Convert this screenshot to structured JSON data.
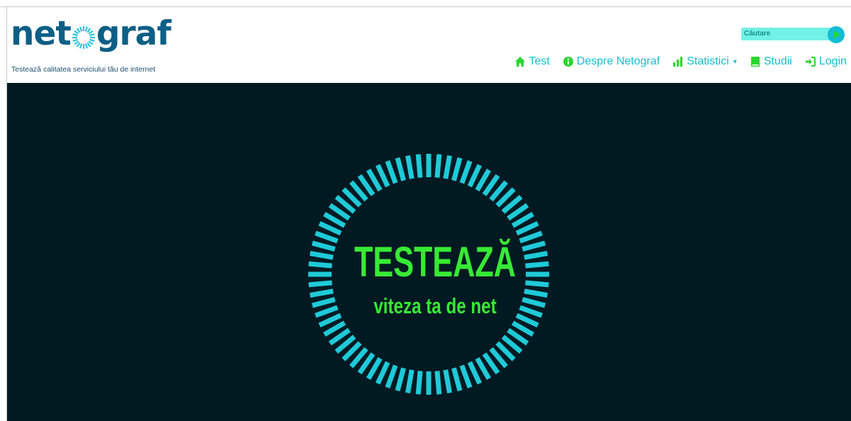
{
  "brand": {
    "logo_prefix": "net",
    "logo_suffix": "graf",
    "tagline": "Testează calitatea serviciului tău de internet"
  },
  "search": {
    "placeholder": "Căutare"
  },
  "nav": {
    "test": "Test",
    "about": "Despre Netograf",
    "stats": "Statistici",
    "studies": "Studii",
    "login": "Login"
  },
  "hero": {
    "title": "TESTEAZĂ",
    "subtitle": "viteza ta de net"
  },
  "colors": {
    "logo_blue": "#0d5f86",
    "accent_cyan": "#11bfcf",
    "accent_green": "#37ea34",
    "hero_bg": "#011a22",
    "dial_cyan": "#1fcad8"
  },
  "icons": {
    "test": "home-icon",
    "about": "info-icon",
    "stats": "bar-chart-icon",
    "studies": "book-icon",
    "login": "login-icon",
    "search": "play-icon"
  }
}
